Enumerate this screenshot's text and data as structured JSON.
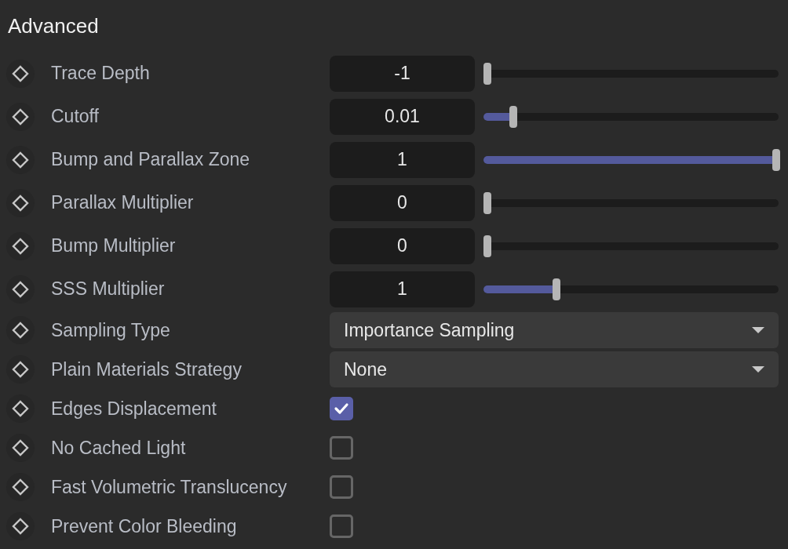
{
  "section": {
    "title": "Advanced"
  },
  "rows": [
    {
      "kind": "slider",
      "label": "Trace Depth",
      "value": "-1",
      "level": 0
    },
    {
      "kind": "slider",
      "label": "Cutoff",
      "value": "0.01",
      "level": 0.09
    },
    {
      "kind": "slider",
      "label": "Bump and Parallax Zone",
      "value": "1",
      "level": 1
    },
    {
      "kind": "slider",
      "label": "Parallax Multiplier",
      "value": "0",
      "level": 0
    },
    {
      "kind": "slider",
      "label": "Bump Multiplier",
      "value": "0",
      "level": 0
    },
    {
      "kind": "slider",
      "label": "SSS Multiplier",
      "value": "1",
      "level": 0.24
    },
    {
      "kind": "dropdown",
      "label": "Sampling Type",
      "value": "Importance Sampling"
    },
    {
      "kind": "dropdown",
      "label": "Plain Materials Strategy",
      "value": "None"
    },
    {
      "kind": "checkbox",
      "label": "Edges Displacement",
      "checked": true
    },
    {
      "kind": "checkbox",
      "label": "No Cached Light",
      "checked": false
    },
    {
      "kind": "checkbox",
      "label": "Fast Volumetric Translucency",
      "checked": false
    },
    {
      "kind": "checkbox",
      "label": "Prevent Color Bleeding",
      "checked": false
    }
  ]
}
